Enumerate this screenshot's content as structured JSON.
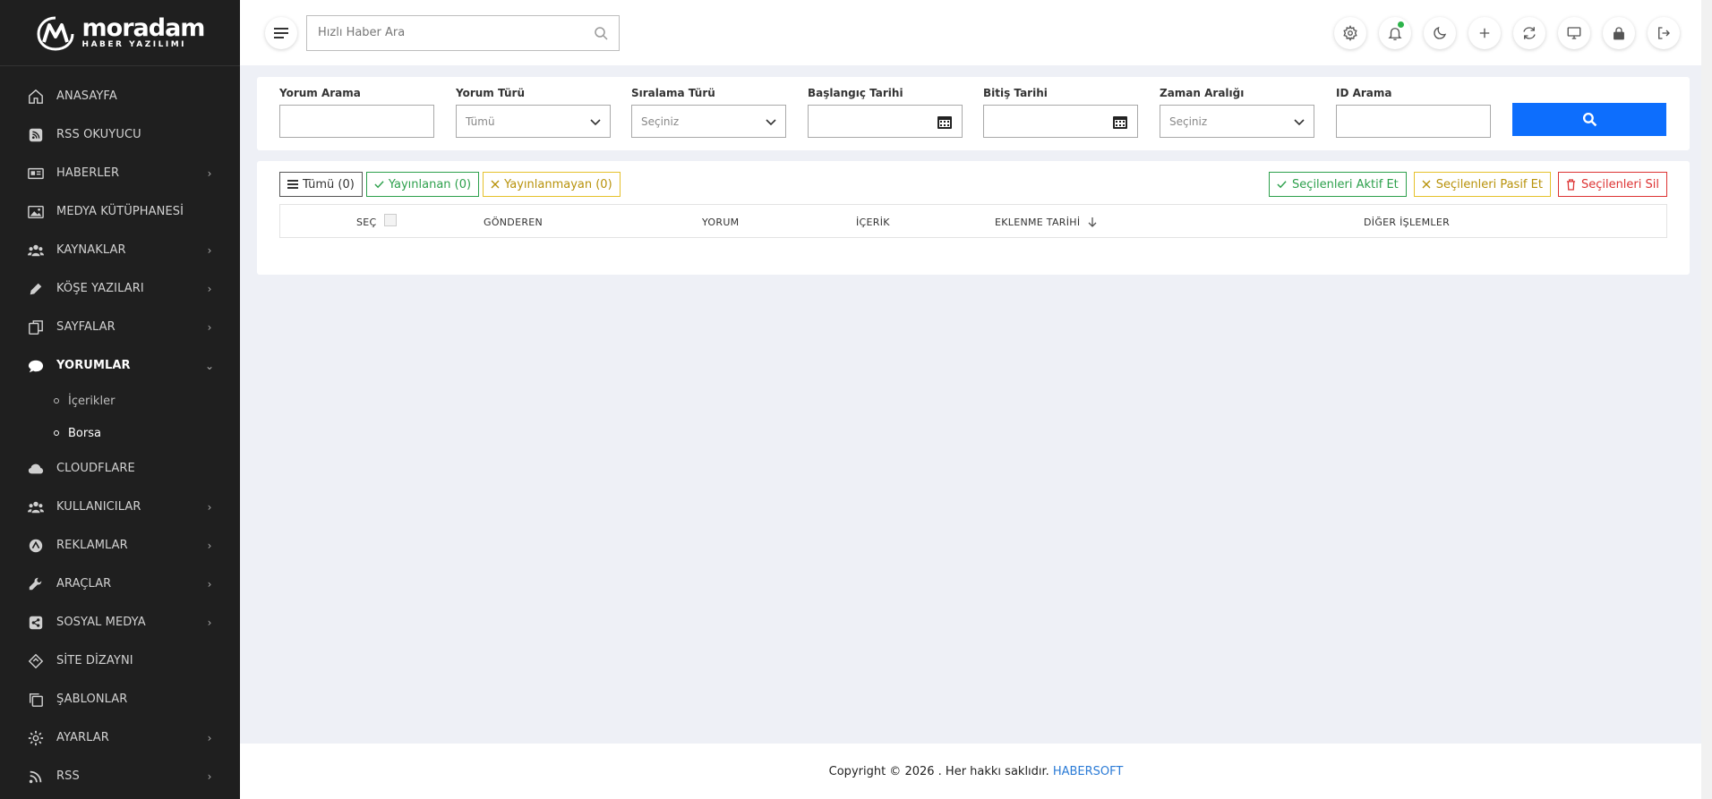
{
  "brand": {
    "name": "moradam",
    "tagline": "HABER YAZILIMI"
  },
  "sidebar": {
    "items": [
      {
        "label": "ANASAYFA",
        "icon": "home-icon",
        "has_children": false
      },
      {
        "label": "RSS OKUYUCU",
        "icon": "rss-square-icon",
        "has_children": false
      },
      {
        "label": "HABERLER",
        "icon": "newspaper-icon",
        "has_children": true
      },
      {
        "label": "MEDYA KÜTÜPHANESİ",
        "icon": "image-icon",
        "has_children": false
      },
      {
        "label": "KAYNAKLAR",
        "icon": "users-icon",
        "has_children": true
      },
      {
        "label": "KÖŞE YAZILARI",
        "icon": "pencil-icon",
        "has_children": true
      },
      {
        "label": "SAYFALAR",
        "icon": "pages-icon",
        "has_children": true
      },
      {
        "label": "YORUMLAR",
        "icon": "comment-icon",
        "has_children": true,
        "expanded": true
      },
      {
        "label": "CLOUDFLARE",
        "icon": "cloud-icon",
        "has_children": false
      },
      {
        "label": "KULLANICILAR",
        "icon": "users-icon",
        "has_children": true
      },
      {
        "label": "REKLAMLAR",
        "icon": "ad-icon",
        "has_children": true
      },
      {
        "label": "ARAÇLAR",
        "icon": "wrench-icon",
        "has_children": true
      },
      {
        "label": "SOSYAL MEDYA",
        "icon": "share-icon",
        "has_children": true
      },
      {
        "label": "SİTE DİZAYNI",
        "icon": "design-icon",
        "has_children": false
      },
      {
        "label": "ŞABLONLAR",
        "icon": "copy-icon",
        "has_children": false
      },
      {
        "label": "AYARLAR",
        "icon": "gear-icon",
        "has_children": true
      },
      {
        "label": "RSS",
        "icon": "rss-icon",
        "has_children": true
      }
    ],
    "yorumlar_sub": [
      {
        "label": "İçerikler"
      },
      {
        "label": "Borsa"
      }
    ]
  },
  "topbar": {
    "search_placeholder": "Hızlı Haber Ara",
    "icons": [
      "settings-icon",
      "bell-icon",
      "moon-icon",
      "plus-icon",
      "refresh-icon",
      "monitor-icon",
      "lock-icon",
      "logout-icon"
    ]
  },
  "filters": {
    "yorum_arama": {
      "label": "Yorum Arama",
      "value": ""
    },
    "yorum_turu": {
      "label": "Yorum Türü",
      "value": "Tümü"
    },
    "siralama_turu": {
      "label": "Sıralama Türü",
      "value": "Seçiniz"
    },
    "baslangic": {
      "label": "Başlangıç Tarihi",
      "value": ""
    },
    "bitis": {
      "label": "Bitiş Tarihi",
      "value": ""
    },
    "zaman": {
      "label": "Zaman Aralığı",
      "value": "Seçiniz"
    },
    "id_arama": {
      "label": "ID Arama",
      "value": ""
    }
  },
  "tabs": {
    "all": "Tümü (0)",
    "published": "Yayınlanan (0)",
    "unpublished": "Yayınlanmayan (0)"
  },
  "actions": {
    "activate": "Seçilenleri Aktif Et",
    "deactivate": "Seçilenleri Pasif Et",
    "delete": "Seçilenleri Sil"
  },
  "table": {
    "columns": [
      "SEÇ",
      "GÖNDEREN",
      "YORUM",
      "İÇERİK",
      "EKLENME TARİHİ",
      "DİĞER İŞLEMLER"
    ],
    "rows": []
  },
  "footer": {
    "text": "Copyright © 2026 . Her hakkı saklıdır.",
    "brand": "HABERSOFT"
  },
  "colors": {
    "sidebar_bg": "#1f1f1f",
    "primary": "#0d6efd",
    "success": "#2da04c",
    "warning": "#e5c12b",
    "danger": "#dd3333",
    "link": "#2b7bd6"
  }
}
